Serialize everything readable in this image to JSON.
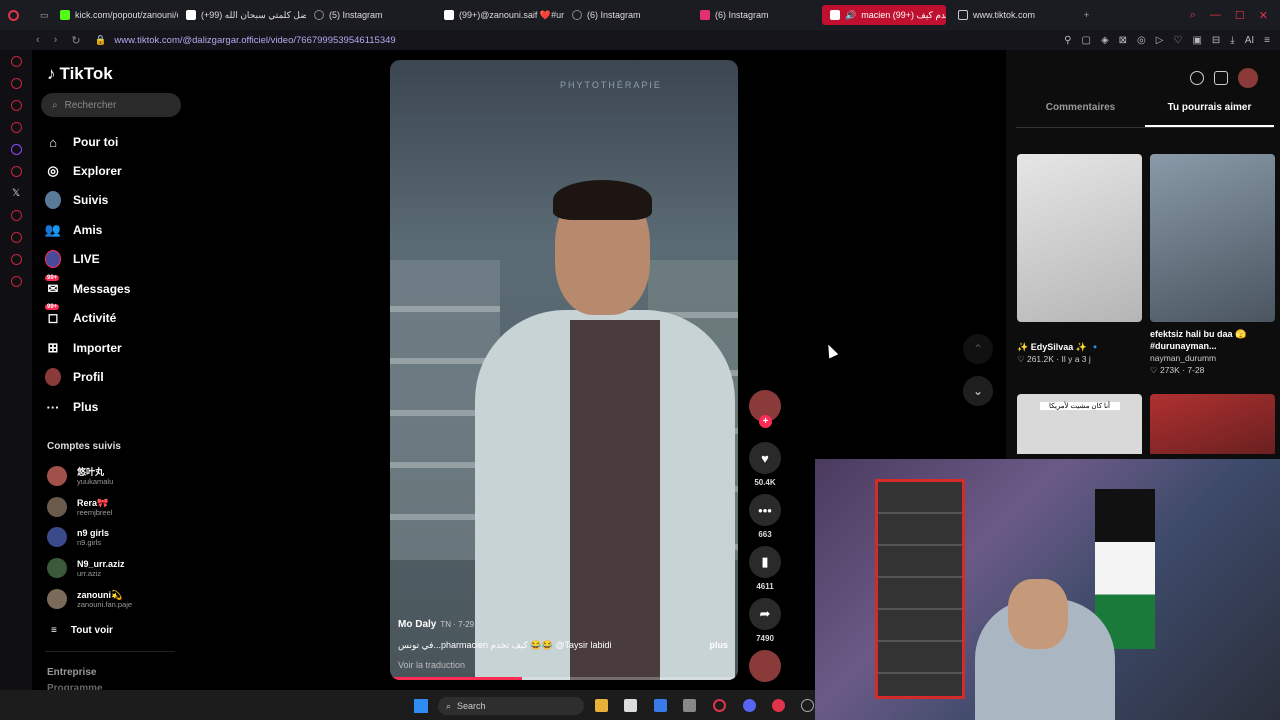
{
  "browser": {
    "tabs": [
      {
        "label": "kick.com/popout/zanouni/c",
        "color": "#53fc18"
      },
      {
        "label": "(+99) فضل كلمتي سبحان الله",
        "color": "#ffffff"
      },
      {
        "label": "(5) Instagram",
        "color": "#888888"
      },
      {
        "label": "(99+)@zanouni.saif ❤️#ur",
        "color": "#ffffff"
      },
      {
        "label": "(6) Instagram",
        "color": "#888888"
      },
      {
        "label": "(6) Instagram",
        "color": "#e1306c"
      },
      {
        "label": "macien تخدم كيف (+99)",
        "color": "#ffffff"
      },
      {
        "label": "www.tiktok.com",
        "color": "#ffffff"
      }
    ],
    "url": "www.tiktok.com/@dalizgargar.officiel/video/7667999539546115349"
  },
  "sidebar": {
    "logo": "TikTok",
    "search_placeholder": "Rechercher",
    "nav": [
      {
        "label": "Pour toi",
        "icon": "home-icon"
      },
      {
        "label": "Explorer",
        "icon": "compass-icon"
      },
      {
        "label": "Suivis",
        "icon": "following-icon"
      },
      {
        "label": "Amis",
        "icon": "friends-icon"
      },
      {
        "label": "LIVE",
        "icon": "live-icon"
      },
      {
        "label": "Messages",
        "icon": "messages-icon",
        "badge": "99+"
      },
      {
        "label": "Activité",
        "icon": "activity-icon",
        "badge": "99+"
      },
      {
        "label": "Importer",
        "icon": "upload-icon"
      },
      {
        "label": "Profil",
        "icon": "profile-icon"
      },
      {
        "label": "Plus",
        "icon": "more-icon"
      }
    ],
    "following_title": "Comptes suivis",
    "accounts": [
      {
        "name": "悠叶丸",
        "handle": "yuukamalu",
        "color": "#a0524a"
      },
      {
        "name": "Rera🎀",
        "handle": "reemjbreel",
        "color": "#6a5a4a"
      },
      {
        "name": "n9 girls",
        "handle": "n9.girls",
        "color": "#3a4a8a"
      },
      {
        "name": "N9_urr.aziz",
        "handle": "urr.aziz",
        "color": "#3a5a3a"
      },
      {
        "name": "zanouni💫",
        "handle": "zanouni.fan.paje",
        "color": "#7a6a5a"
      }
    ],
    "see_all": "Tout voir",
    "footer_1": "Entreprise",
    "footer_2": "Programme"
  },
  "video": {
    "top_text": "PHYTOTHÉRAPIE",
    "author": "Mo Daly",
    "author_meta": "TN · 7-29",
    "description": "في تونس...pharmacien كيف تخدم 😂😂 @Taysir labidi",
    "more": "plus",
    "translate": "Voir la traduction",
    "progress": 0.38
  },
  "actions": {
    "likes": "50.4K",
    "comments": "663",
    "saves": "4611",
    "shares": "7490"
  },
  "right_panel": {
    "tabs": [
      "Commentaires",
      "Tu pourrais aimer"
    ],
    "active_tab": 1,
    "items": [
      {
        "title": "✨ EdySilvaa ✨ 🔹",
        "stats": "♡ 261.2K · Il y a 3 j",
        "color": "#dcdcdc"
      },
      {
        "title": "efektsiz hali bu daa 🫣 #durunayman...",
        "sub": "nayman_durumm",
        "stats": "♡ 273K · 7-28",
        "color": "#6a7a8a"
      },
      {
        "title": "",
        "overlay": "أنا كان مشيت لأمريكا",
        "color": "#d9d9d9"
      },
      {
        "title": "",
        "color": "#8a3030"
      }
    ]
  },
  "taskbar": {
    "search": "Search"
  }
}
